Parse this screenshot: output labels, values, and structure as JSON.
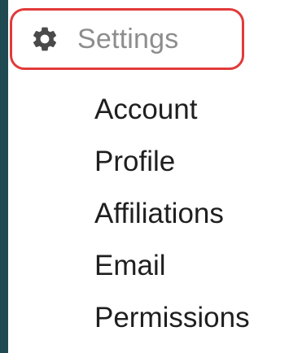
{
  "colors": {
    "page_background": "#1f4a52",
    "panel_background": "#ffffff",
    "highlight_border": "#e23a3a",
    "header_text": "#8d8d8d",
    "menu_text": "#1f1f1f"
  },
  "settings": {
    "icon": "gear-icon",
    "label": "Settings"
  },
  "menu": {
    "items": [
      {
        "label": "Account"
      },
      {
        "label": "Profile"
      },
      {
        "label": "Affiliations"
      },
      {
        "label": "Email"
      },
      {
        "label": "Permissions"
      }
    ]
  }
}
